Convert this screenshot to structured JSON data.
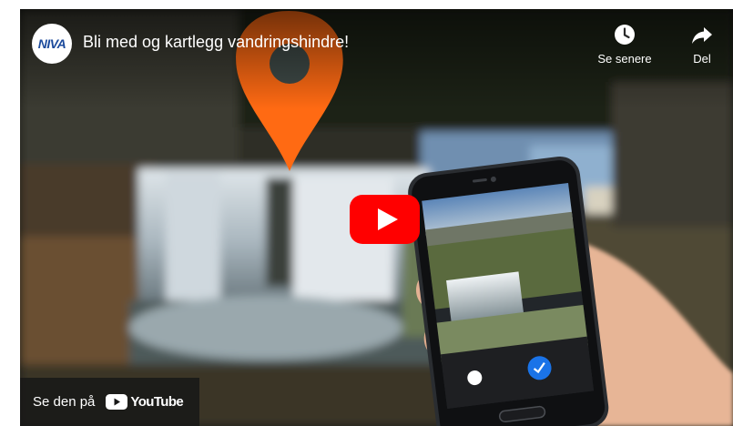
{
  "video": {
    "channel_logo_text": "NIVA",
    "title": "Bli med og kartlegg vandringshindre!"
  },
  "actions": {
    "watch_later_label": "Se senere",
    "share_label": "Del"
  },
  "watch_on": {
    "label": "Se den på",
    "brand": "YouTube"
  },
  "colors": {
    "play_button_red": "#ff0000",
    "map_pin_orange": "#ff6a13",
    "overlay_dark": "#171717"
  },
  "icons": {
    "watch_later": "clock-icon",
    "share": "share-arrow-icon",
    "play": "play-icon",
    "youtube": "youtube-logo-icon"
  }
}
